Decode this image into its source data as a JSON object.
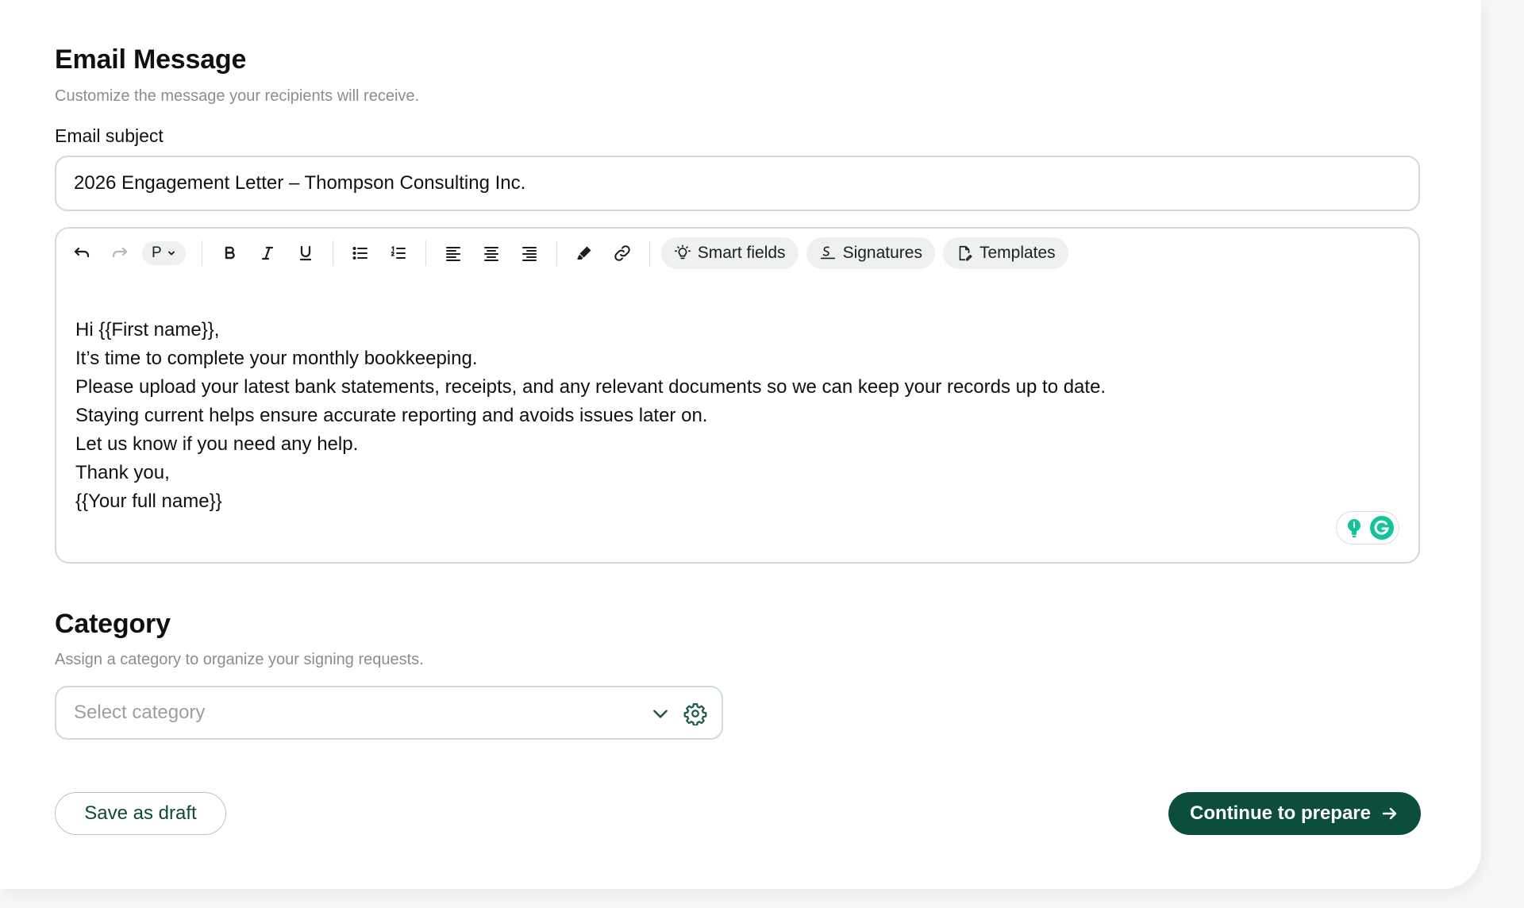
{
  "email_section": {
    "title": "Email Message",
    "subtitle": "Customize the message your recipients will receive.",
    "subject_label": "Email subject",
    "subject_value": "2026 Engagement Letter – Thompson Consulting Inc."
  },
  "editor": {
    "toolbar": {
      "paragraph_format": "P",
      "smart_fields_label": "Smart fields",
      "signatures_label": "Signatures",
      "templates_label": "Templates"
    },
    "body_lines": [
      "Hi {{First name}},",
      "It’s time to complete your monthly bookkeeping.",
      "Please upload your latest bank statements, receipts, and any relevant documents so we can keep your records up to date.",
      "Staying current helps ensure accurate reporting and avoids issues later on.",
      "Let us know if you need any help.",
      "Thank you,",
      "{{Your full name}}"
    ]
  },
  "category_section": {
    "title": "Category",
    "subtitle": "Assign a category to organize your signing requests.",
    "select_placeholder": "Select category"
  },
  "actions": {
    "save_draft_label": "Save as draft",
    "continue_label": "Continue to prepare"
  },
  "colors": {
    "primary": "#0c4d3c",
    "border": "#cfdcd9",
    "muted_text": "#8a8f8e",
    "grammarly": "#15c39a"
  },
  "icons": [
    "undo-icon",
    "redo-icon",
    "chevron-down-icon",
    "bold-icon",
    "italic-icon",
    "underline-icon",
    "bullet-list-icon",
    "numbered-list-icon",
    "align-left-icon",
    "align-center-icon",
    "align-right-icon",
    "highlighter-icon",
    "link-icon",
    "lightbulb-icon",
    "signature-icon",
    "template-icon",
    "gear-icon",
    "arrow-right-icon",
    "grammarly-icon"
  ]
}
